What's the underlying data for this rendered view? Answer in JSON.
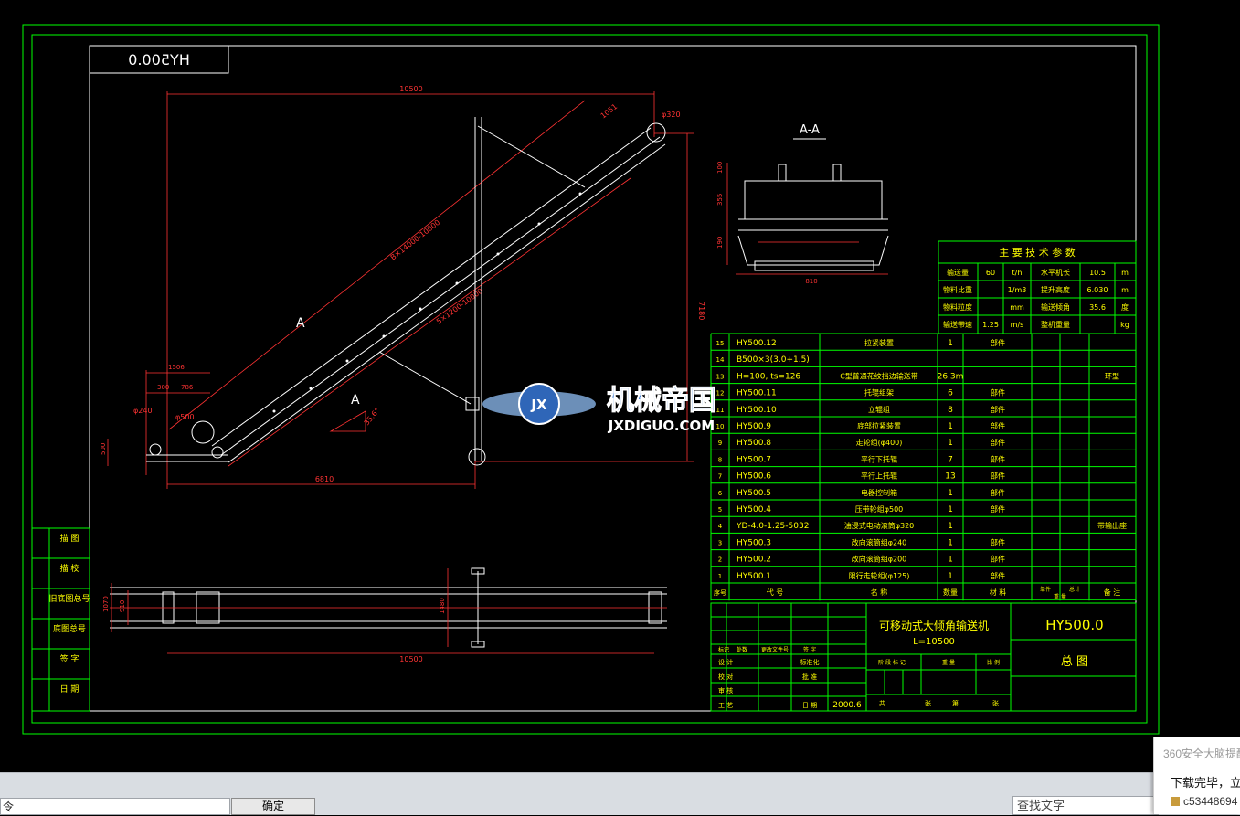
{
  "drawing": {
    "drawing_number_mirrored": "HY500.0",
    "section_label": "A-A",
    "view_marker": "A",
    "dims": {
      "overall_length": "10500",
      "belt_length": "B×14000-10000",
      "inclined_length": "5×1200-10000",
      "height": "7180",
      "base_length": "6810",
      "top_length": "1051",
      "pulley_dia": "φ320",
      "small_pulley": "φ500",
      "pulley_small2": "φ240",
      "d300": "300",
      "d786": "786",
      "d1506": "1506",
      "d500": "500",
      "angle": "35.6°",
      "plan_length": "10500",
      "plan_w1": "1070",
      "plan_w2": "910",
      "plan_w3": "1480",
      "sec_h1": "100",
      "sec_h2": "355",
      "sec_h3": "190",
      "sec_w": "810"
    },
    "tech_params": {
      "title": "主 要 技 术 参 数",
      "rows": [
        [
          "输送量",
          "60",
          "t/h",
          "水平机长",
          "10.5",
          "m"
        ],
        [
          "物料比重",
          "",
          "1/m3",
          "提升高度",
          "6.030",
          "m"
        ],
        [
          "物料粒度",
          "",
          "mm",
          "输送倾角",
          "35.6",
          "度"
        ],
        [
          "输送带速",
          "1.25",
          "m/s",
          "整机重量",
          "",
          "kg"
        ]
      ]
    },
    "parts": [
      {
        "no": "15",
        "code": "HY500.12",
        "name": "拉紧装置",
        "qty": "1",
        "mat": "部件",
        "note": ""
      },
      {
        "no": "14",
        "code": "B500×3(3.0+1.5)",
        "name": "",
        "qty": "",
        "mat": "",
        "note": ""
      },
      {
        "no": "13",
        "code": "H=100, ts=126",
        "name": "C型普通花纹挡边输送带",
        "qty": "26.3m",
        "mat": "",
        "note": "环型"
      },
      {
        "no": "12",
        "code": "HY500.11",
        "name": "托辊组架",
        "qty": "6",
        "mat": "部件",
        "note": ""
      },
      {
        "no": "11",
        "code": "HY500.10",
        "name": "立辊组",
        "qty": "8",
        "mat": "部件",
        "note": ""
      },
      {
        "no": "10",
        "code": "HY500.9",
        "name": "底部拉紧装置",
        "qty": "1",
        "mat": "部件",
        "note": ""
      },
      {
        "no": "9",
        "code": "HY500.8",
        "name": "走轮组(φ400)",
        "qty": "1",
        "mat": "部件",
        "note": ""
      },
      {
        "no": "8",
        "code": "HY500.7",
        "name": "平行下托辊",
        "qty": "7",
        "mat": "部件",
        "note": ""
      },
      {
        "no": "7",
        "code": "HY500.6",
        "name": "平行上托辊",
        "qty": "13",
        "mat": "部件",
        "note": ""
      },
      {
        "no": "6",
        "code": "HY500.5",
        "name": "电器控制箱",
        "qty": "1",
        "mat": "部件",
        "note": ""
      },
      {
        "no": "5",
        "code": "HY500.4",
        "name": "压带轮组φ500",
        "qty": "1",
        "mat": "部件",
        "note": ""
      },
      {
        "no": "4",
        "code": "YD-4.0-1.25-5032",
        "name": "油浸式电动滚筒φ320",
        "qty": "1",
        "mat": "",
        "note": "带输出座"
      },
      {
        "no": "3",
        "code": "HY500.3",
        "name": "改向滚筒组φ240",
        "qty": "1",
        "mat": "部件",
        "note": ""
      },
      {
        "no": "2",
        "code": "HY500.2",
        "name": "改向滚筒组φ200",
        "qty": "1",
        "mat": "部件",
        "note": ""
      },
      {
        "no": "1",
        "code": "HY500.1",
        "name": "限行走轮组(φ125)",
        "qty": "1",
        "mat": "部件",
        "note": ""
      }
    ],
    "parts_header": {
      "no": "序号",
      "code": "代 号",
      "name": "名 称",
      "qty": "数量",
      "mat": "材 料",
      "single": "单件",
      "total": "总计",
      "weight": "重 量",
      "note": "备 注"
    },
    "title_block": {
      "product_name": "可移动式大倾角输送机",
      "product_sub": "L=10500",
      "drawing_no": "HY500.0",
      "drawing_title": "总 图",
      "date": "2000.6",
      "labels": {
        "design": "设 计",
        "check": "校 对",
        "review": "审 核",
        "process": "工 艺",
        "standard": "标准化",
        "approve": "批 准",
        "date_label": "日 期",
        "mark": "标记",
        "count": "处数",
        "change_doc": "更改文件号",
        "sign": "签 字",
        "stage_mark": "阶 段 标 记",
        "weight": "重 量",
        "ratio": "比 例",
        "total_sheets": "共",
        "sheet": "张",
        "page": "第",
        "sheet2": "张"
      }
    },
    "side_labels": [
      "描 图",
      "描 校",
      "旧底图总号",
      "底图总号",
      "签 字",
      "日 期"
    ],
    "watermark": {
      "cn": "机械帝国",
      "en": "JXDIGUO.COM",
      "logo": "JX"
    }
  },
  "statusbar": {
    "left_text": "令",
    "ok_label": "确定",
    "find_placeholder": "查找文字"
  },
  "notification": {
    "title": "360安全大脑提醒",
    "message": "下载完毕，立",
    "file": "c53448694"
  },
  "colors": {
    "background": "#000000",
    "frame": "#00ff00",
    "dims": "#ff3333",
    "text": "#ffff00",
    "part": "#ffffff"
  }
}
